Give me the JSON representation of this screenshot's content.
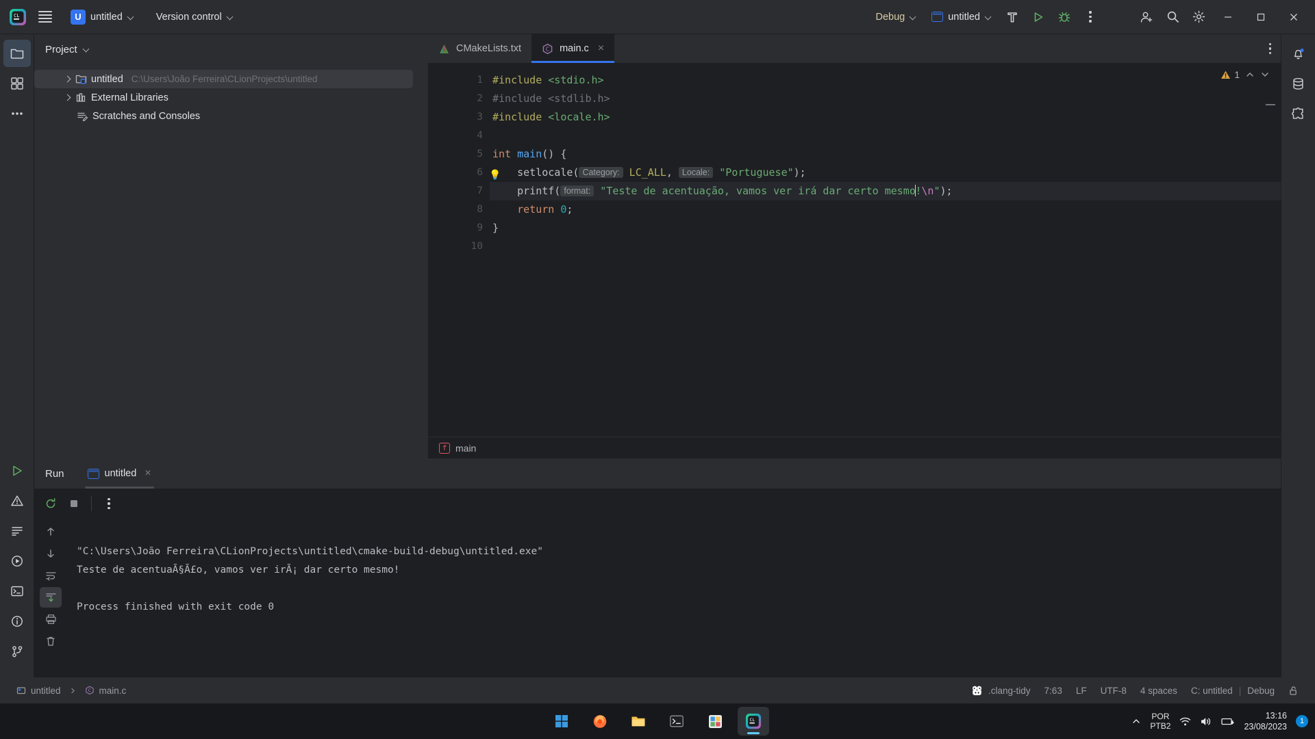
{
  "toolbar": {
    "menu_icon": "hamburger-icon",
    "project_badge": "U",
    "project_name": "untitled",
    "version_control": "Version control",
    "build_config": "Debug",
    "run_config": "untitled",
    "build_icon": "hammer-icon",
    "run_icon": "run-triangle-icon",
    "debug_icon": "debug-bug-icon",
    "more_icon": "kebab-icon",
    "account_icon": "account-icon",
    "search_icon": "search-icon",
    "settings_icon": "gear-icon",
    "minimize": "—",
    "maximize": "☐",
    "close": "✕"
  },
  "sidebar": {
    "left_items": [
      {
        "name": "project-tool-window",
        "icon": "folder-icon",
        "active": true
      },
      {
        "name": "commit-tool-window",
        "icon": "commit-icon",
        "active": false
      },
      {
        "name": "more-tool-windows",
        "icon": "ellipsis-icon",
        "active": false
      }
    ],
    "left_bottom_items": [
      {
        "name": "run-tool-window",
        "icon": "run-icon"
      },
      {
        "name": "problems-tool-window",
        "icon": "warning-icon"
      },
      {
        "name": "todo-tool-window",
        "icon": "list-icon"
      },
      {
        "name": "debug-tool-window",
        "icon": "debug-play-icon"
      },
      {
        "name": "terminal-tool-window",
        "icon": "terminal-icon"
      },
      {
        "name": "notifications-tool-window",
        "icon": "info-icon"
      },
      {
        "name": "version-control-tool-window",
        "icon": "branch-icon"
      }
    ],
    "right_items": [
      {
        "name": "notifications",
        "icon": "bell-icon"
      },
      {
        "name": "database",
        "icon": "database-icon"
      },
      {
        "name": "plugins",
        "icon": "puzzle-icon"
      }
    ]
  },
  "project_panel": {
    "title": "Project",
    "tree": [
      {
        "label": "untitled",
        "path": "C:\\Users\\João Ferreira\\CLionProjects\\untitled",
        "icon": "project-folder-icon",
        "selected": true,
        "expandable": true,
        "indent": 0
      },
      {
        "label": "External Libraries",
        "path": "",
        "icon": "library-icon",
        "selected": false,
        "expandable": true,
        "indent": 0
      },
      {
        "label": "Scratches and Consoles",
        "path": "",
        "icon": "scratch-icon",
        "selected": false,
        "expandable": false,
        "indent": 0
      }
    ]
  },
  "editor": {
    "tabs": [
      {
        "label": "CMakeLists.txt",
        "icon": "cmake-icon",
        "active": false,
        "closable": false
      },
      {
        "label": "main.c",
        "icon": "c-file-icon",
        "active": true,
        "closable": true,
        "close_glyph": "×"
      }
    ],
    "warning_count": "1",
    "warning_icon": "warning-triangle-icon",
    "breadcrumb": {
      "label": "main",
      "badge": "f"
    },
    "lines": [
      {
        "n": "1",
        "marker": "",
        "bulb": false,
        "current": false,
        "tokens": [
          {
            "t": "#include ",
            "c": "dir"
          },
          {
            "t": "<stdio.h>",
            "c": "hdr"
          }
        ]
      },
      {
        "n": "2",
        "marker": "",
        "bulb": false,
        "current": false,
        "tokens": [
          {
            "t": "#include <stdlib.h>",
            "c": "dim"
          }
        ]
      },
      {
        "n": "3",
        "marker": "",
        "bulb": false,
        "current": false,
        "tokens": [
          {
            "t": "#include ",
            "c": "dir"
          },
          {
            "t": "<locale.h>",
            "c": "hdr"
          }
        ]
      },
      {
        "n": "4",
        "marker": "",
        "bulb": false,
        "current": false,
        "tokens": []
      },
      {
        "n": "5",
        "marker": "run",
        "bulb": false,
        "current": false,
        "tokens": [
          {
            "t": "int ",
            "c": "kw"
          },
          {
            "t": "main",
            "c": "fn"
          },
          {
            "t": "() {",
            "c": "plain"
          }
        ]
      },
      {
        "n": "6",
        "marker": "",
        "bulb": true,
        "current": false,
        "tokens": [
          {
            "t": "    setlocale(",
            "c": "plain"
          },
          {
            "t": "Category:",
            "c": "hint"
          },
          {
            "t": " ",
            "c": "plain"
          },
          {
            "t": "LC_ALL",
            "c": "dir"
          },
          {
            "t": ", ",
            "c": "plain"
          },
          {
            "t": "Locale:",
            "c": "hint"
          },
          {
            "t": " ",
            "c": "plain"
          },
          {
            "t": "\"Portuguese\"",
            "c": "str"
          },
          {
            "t": ");",
            "c": "plain"
          }
        ]
      },
      {
        "n": "7",
        "marker": "",
        "bulb": false,
        "current": true,
        "tokens": [
          {
            "t": "    printf(",
            "c": "plain"
          },
          {
            "t": "format:",
            "c": "hint"
          },
          {
            "t": " ",
            "c": "plain"
          },
          {
            "t": "\"Teste de acentuação, vamos ver irá dar certo mesmo",
            "c": "str"
          },
          {
            "t": "CARET",
            "c": "caret"
          },
          {
            "t": "!",
            "c": "str"
          },
          {
            "t": "\\n",
            "c": "cst"
          },
          {
            "t": "\"",
            "c": "str"
          },
          {
            "t": ");",
            "c": "plain"
          }
        ]
      },
      {
        "n": "8",
        "marker": "",
        "bulb": false,
        "current": false,
        "tokens": [
          {
            "t": "    ",
            "c": "plain"
          },
          {
            "t": "return ",
            "c": "kw"
          },
          {
            "t": "0",
            "c": "num"
          },
          {
            "t": ";",
            "c": "plain"
          }
        ]
      },
      {
        "n": "9",
        "marker": "",
        "bulb": false,
        "current": false,
        "tokens": [
          {
            "t": "}",
            "c": "plain"
          }
        ]
      },
      {
        "n": "10",
        "marker": "",
        "bulb": false,
        "current": false,
        "tokens": []
      }
    ]
  },
  "run_panel": {
    "title": "Run",
    "tab_label": "untitled",
    "tab_icon": "run-config-icon",
    "tab_close": "×",
    "toolbar": [
      {
        "name": "rerun-button",
        "icon": "rerun-icon"
      },
      {
        "name": "stop-button",
        "icon": "stop-icon"
      },
      {
        "name": "more-options-button",
        "icon": "kebab-icon"
      }
    ],
    "side_toolbar": [
      {
        "name": "scroll-up-button",
        "icon": "arrow-up-icon",
        "selected": false
      },
      {
        "name": "scroll-down-button",
        "icon": "arrow-down-icon",
        "selected": false
      },
      {
        "name": "soft-wrap-button",
        "icon": "soft-wrap-icon",
        "selected": false
      },
      {
        "name": "scroll-to-end-button",
        "icon": "scroll-end-icon",
        "selected": true
      },
      {
        "name": "print-button",
        "icon": "print-icon",
        "selected": false
      },
      {
        "name": "clear-all-button",
        "icon": "trash-icon",
        "selected": false
      }
    ],
    "console_lines": [
      "\"C:\\Users\\João Ferreira\\CLionProjects\\untitled\\cmake-build-debug\\untitled.exe\"",
      "Teste de acentuaÃ§Ã£o, vamos ver irÃ¡ dar certo mesmo!",
      "",
      "Process finished with exit code 0"
    ]
  },
  "statusbar": {
    "project_icon": "project-icon",
    "project": "untitled",
    "file_icon": "c-file-icon",
    "file": "main.c",
    "inspections_icon": "clang-tidy-icon",
    "inspections": ".clang-tidy",
    "caret_position": "7:63",
    "line_separator": "LF",
    "encoding": "UTF-8",
    "indent": "4 spaces",
    "config": "C: untitled",
    "config_separator": "|",
    "config_mode": "Debug",
    "lock_icon": "unlock-icon"
  },
  "taskbar": {
    "apps": [
      {
        "name": "start-button",
        "icon": "windows-icon",
        "active": false
      },
      {
        "name": "firefox-taskbar-icon",
        "icon": "firefox-icon",
        "active": false
      },
      {
        "name": "file-explorer-taskbar-icon",
        "icon": "folder-icon",
        "active": false
      },
      {
        "name": "terminal-taskbar-icon",
        "icon": "terminal-icon",
        "active": false
      },
      {
        "name": "store-taskbar-icon",
        "icon": "store-icon",
        "active": false
      },
      {
        "name": "clion-taskbar-icon",
        "icon": "clion-icon",
        "active": true
      }
    ],
    "tray_expand_icon": "chevron-up-icon",
    "language_line1": "POR",
    "language_line2": "PTB2",
    "wifi_icon": "wifi-icon",
    "volume_icon": "volume-icon",
    "battery_icon": "battery-icon",
    "time": "13:16",
    "date": "23/08/2023",
    "notification_count": "1"
  }
}
